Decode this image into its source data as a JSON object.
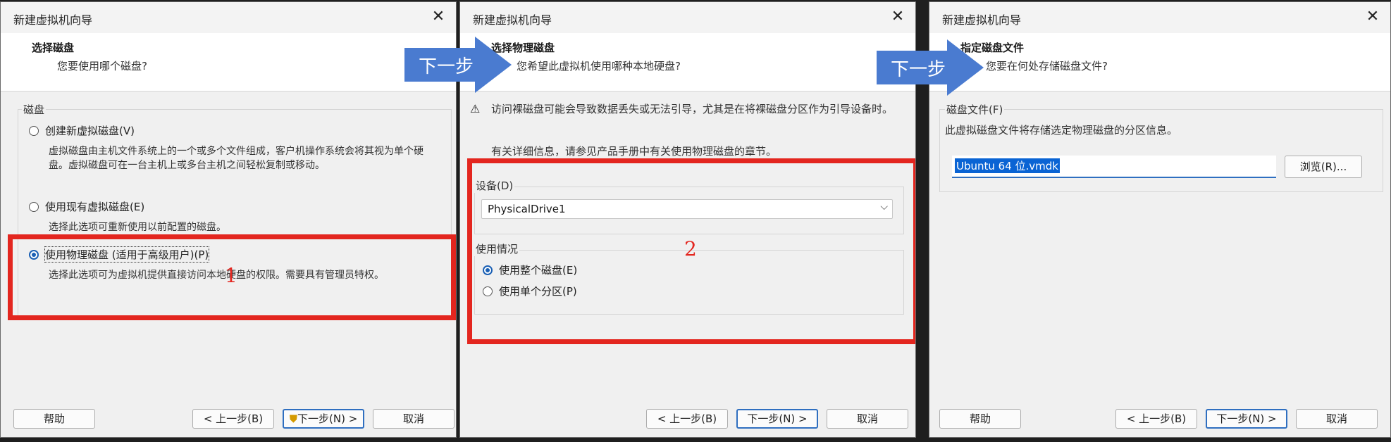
{
  "dialog1": {
    "title": "新建虚拟机向导",
    "header_title": "选择磁盘",
    "header_subtitle": "您要使用哪个磁盘?",
    "group_label": "磁盘",
    "options": [
      {
        "label": "创建新虚拟磁盘(V)",
        "desc": "虚拟磁盘由主机文件系统上的一个或多个文件组成，客户机操作系统会将其视为单个硬盘。虚拟磁盘可在一台主机上或多台主机之间轻松复制或移动。",
        "selected": false
      },
      {
        "label": "使用现有虚拟磁盘(E)",
        "desc": "选择此选项可重新使用以前配置的磁盘。",
        "selected": false
      },
      {
        "label": "使用物理磁盘 (适用于高级用户)(P)",
        "desc": "选择此选项可为虚拟机提供直接访问本地硬盘的权限。需要具有管理员特权。",
        "selected": true
      }
    ],
    "buttons": {
      "help": "帮助",
      "back": "< 上一步(B)",
      "next": "下一步(N) >",
      "cancel": "取消"
    },
    "annotation": "1"
  },
  "dialog2": {
    "title": "新建虚拟机向导",
    "header_title": "选择物理磁盘",
    "header_subtitle": "您希望此虚拟机使用哪种本地硬盘?",
    "warning": "访问裸磁盘可能会导致数据丢失或无法引导，尤其是在将裸磁盘分区作为引导设备时。",
    "info": "有关详细信息，请参见产品手册中有关使用物理磁盘的章节。",
    "device_label": "设备(D)",
    "device_value": "PhysicalDrive1",
    "usage_label": "使用情况",
    "usage_options": [
      {
        "label": "使用整个磁盘(E)",
        "selected": true
      },
      {
        "label": "使用单个分区(P)",
        "selected": false
      }
    ],
    "buttons": {
      "back": "< 上一步(B)",
      "next": "下一步(N) >",
      "cancel": "取消"
    },
    "annotation": "2"
  },
  "dialog3": {
    "title": "新建虚拟机向导",
    "header_title": "指定磁盘文件",
    "header_subtitle": "您要在何处存储磁盘文件?",
    "group_label": "磁盘文件(F)",
    "group_desc": "此虚拟磁盘文件将存储选定物理磁盘的分区信息。",
    "file_value": "Ubuntu 64 位.vmdk",
    "browse_label": "浏览(R)...",
    "buttons": {
      "help": "帮助",
      "back": "< 上一步(B)",
      "next": "下一步(N) >",
      "cancel": "取消"
    }
  },
  "arrows": [
    {
      "label": "下一步"
    },
    {
      "label": "下一步"
    }
  ],
  "colors": {
    "annotation_red": "#e3261f",
    "arrow_blue": "#4a7bd0",
    "accent": "#1a5fb4"
  }
}
